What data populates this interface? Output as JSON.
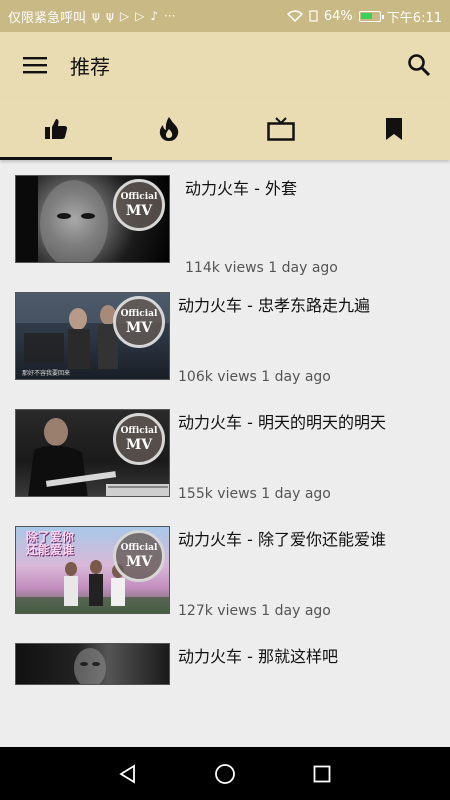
{
  "status_bar": {
    "carrier_text": "仅限紧急呼叫",
    "notif_icons": [
      "usb-icon",
      "usb-icon",
      "play-icon",
      "play-icon",
      "bell-icon",
      "more-icon"
    ],
    "battery_text": "64%",
    "battery_level": 0.64,
    "time": "下午6:11"
  },
  "app_bar": {
    "title": "推荐",
    "menu_icon": "hamburger-icon",
    "search_icon": "search-icon"
  },
  "tabs": [
    {
      "icon": "thumbs-up-icon",
      "active": true
    },
    {
      "icon": "fire-icon",
      "active": false
    },
    {
      "icon": "tv-icon",
      "active": false
    },
    {
      "icon": "bookmark-icon",
      "active": false
    }
  ],
  "badge": {
    "line1": "Official",
    "line2": "MV"
  },
  "videos": [
    {
      "title": "动力火车 - 外套",
      "meta": "114k views 1 day ago"
    },
    {
      "title": "动力火车 - 忠孝东路走九遍",
      "meta": "106k views 1 day ago"
    },
    {
      "title": "动力火车 - 明天的明天的明天",
      "meta": "155k views 1 day ago"
    },
    {
      "title": "动力火车 - 除了爱你还能爱谁",
      "meta": "127k views 1 day ago"
    },
    {
      "title": "动力火车 - 那就这样吧",
      "meta": ""
    }
  ],
  "thumb_text": {
    "item2": "那好不容我要回来",
    "item4_line1": "除了爱你",
    "item4_line2": "还能爱谁"
  },
  "colors": {
    "accent": "#eadcb2",
    "status_bar": "#c9b985",
    "background": "#ededed"
  }
}
